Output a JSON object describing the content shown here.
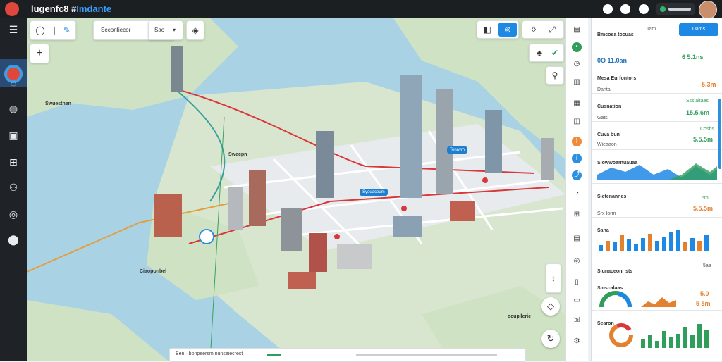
{
  "app": {
    "title_a": "lugenfc8 #",
    "title_b": "Imdante"
  },
  "colors": {
    "accent": "#1e88e5",
    "positive": "#2f9e5b",
    "warning": "#e2812f",
    "route": "#d9383a"
  },
  "toolbar": {
    "search_label": "Seconfiecor",
    "filter_label": "Sao",
    "filter_caret": "▾"
  },
  "map": {
    "labels": [
      "Swuesthen",
      "Swecpn",
      "Ciaoponbel",
      "ocupllerie"
    ],
    "callouts": [
      "Tenavm",
      "Syouaceum"
    ]
  },
  "bottom_bar": {
    "text": "Ben · bonpeersm nunseiecrest"
  },
  "panel": {
    "header_title": "Bmcosa tocuas",
    "header_select": "Tam",
    "header_button": "Dams",
    "kpi_left": "0O 11.0an",
    "kpi_right": "6 5.1ns",
    "section1_title": "Mesa Eurfontors",
    "row1_label": "Danta",
    "row1_value": "5.3m",
    "row2_title": "Cusnation",
    "row2_right_title": "Ssslaitaes",
    "row2_label": "Gats",
    "row2_value": "15.5.6m",
    "row3_title": "Cuva bun",
    "row3_right_title": "Cosbs",
    "row3_label": "Wieaaon",
    "row3_value": "5.5.5m",
    "area_title": "Siowwoarnuauaa",
    "row4_title": "Sietenannes",
    "row4_label": "Srx Iorm",
    "row4_value": "5.5.5m",
    "row4_right": "5m",
    "bars_title": "Sana",
    "row5_title": "Siunaceonr sts",
    "row5_right": "5aa",
    "row6_title": "Smscalaas",
    "row6_value1": "5.0",
    "row6_value2": "5 5m",
    "last_title": "Searon"
  }
}
